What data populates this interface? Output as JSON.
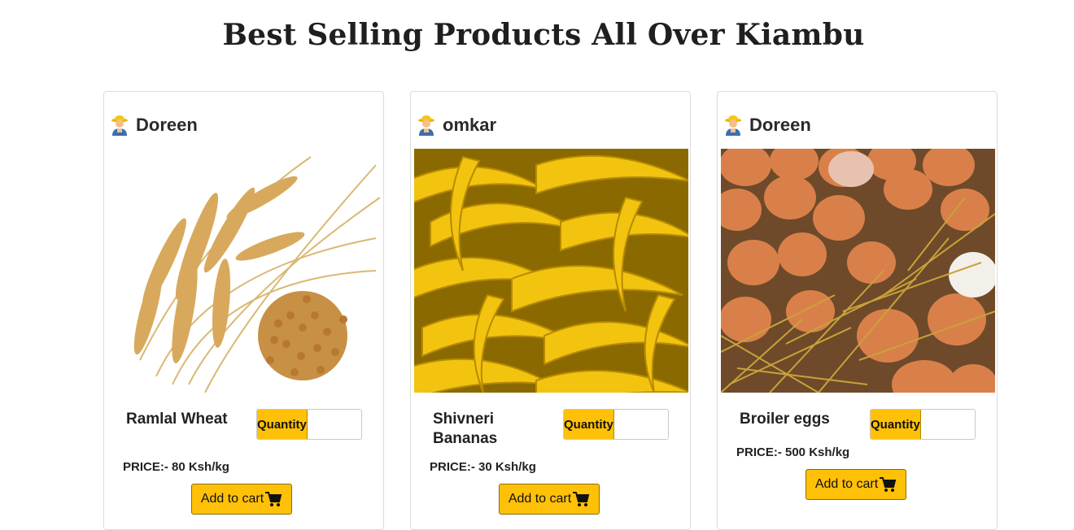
{
  "page": {
    "title": "Best Selling Products All Over Kiambu"
  },
  "colors": {
    "accent": "#ffc107",
    "card_border": "#dcdcdc"
  },
  "products": [
    {
      "seller": "Doreen",
      "seller_icon": "farmer-icon",
      "image": "wheat-image",
      "name": "Ramlal Wheat",
      "quantity_label": "Quantity",
      "quantity_value": "",
      "price": "PRICE:- 80 Ksh/kg",
      "cart_label": "Add to cart",
      "cart_icon": "shopping-cart-icon"
    },
    {
      "seller": "omkar",
      "seller_icon": "farmer-icon",
      "image": "bananas-image",
      "name": "Shivneri Bananas",
      "quantity_label": "Quantity",
      "quantity_value": "",
      "price": "PRICE:- 30 Ksh/kg",
      "cart_label": "Add to cart",
      "cart_icon": "shopping-cart-icon"
    },
    {
      "seller": "Doreen",
      "seller_icon": "farmer-icon",
      "image": "eggs-image",
      "name": "Broiler eggs",
      "quantity_label": "Quantity",
      "quantity_value": "",
      "price": "PRICE:- 500 Ksh/kg",
      "cart_label": "Add to cart",
      "cart_icon": "shopping-cart-icon"
    }
  ]
}
